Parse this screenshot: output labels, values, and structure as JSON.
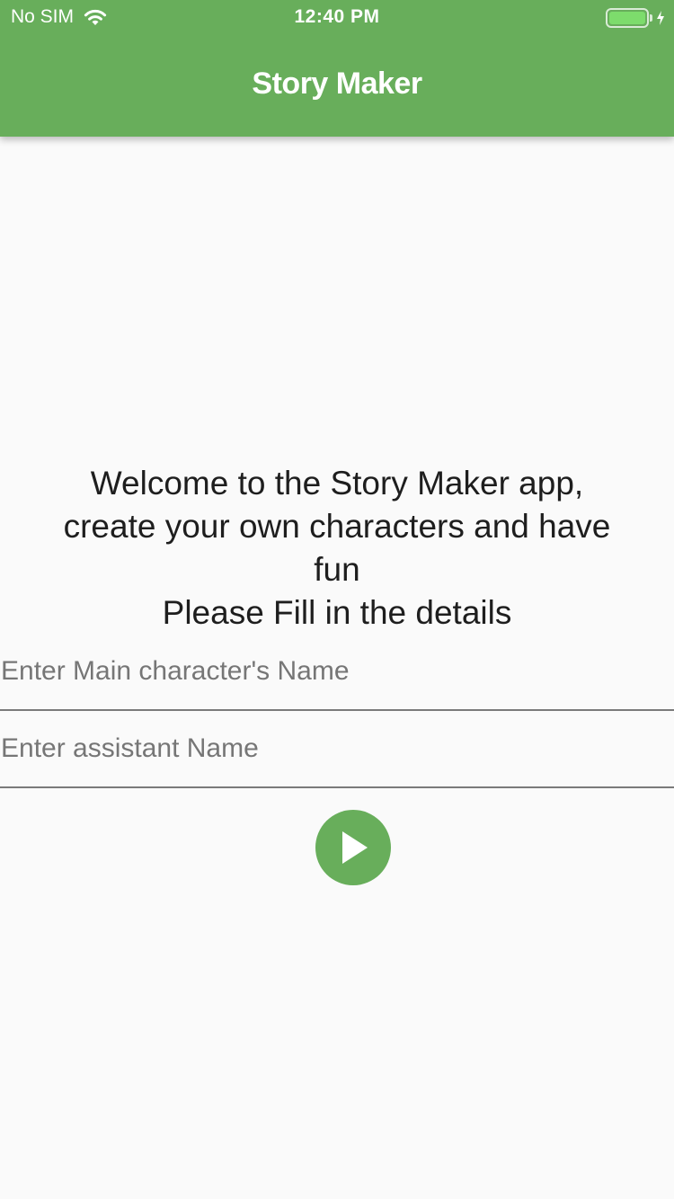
{
  "status_bar": {
    "carrier": "No SIM",
    "time": "12:40 PM",
    "battery_level": 1.0
  },
  "app_bar": {
    "title": "Story Maker"
  },
  "main": {
    "welcome_text": "Welcome to the Story Maker app,\ncreate your own characters and have\nfun\nPlease Fill in the details",
    "main_character_field": {
      "placeholder": "Enter Main character's Name",
      "value": ""
    },
    "assistant_field": {
      "placeholder": "Enter assistant Name",
      "value": ""
    },
    "submit_icon": "play-icon"
  },
  "colors": {
    "accent": "#68ae5b",
    "background": "#fafafa",
    "battery_fill": "#7ddc6c"
  }
}
